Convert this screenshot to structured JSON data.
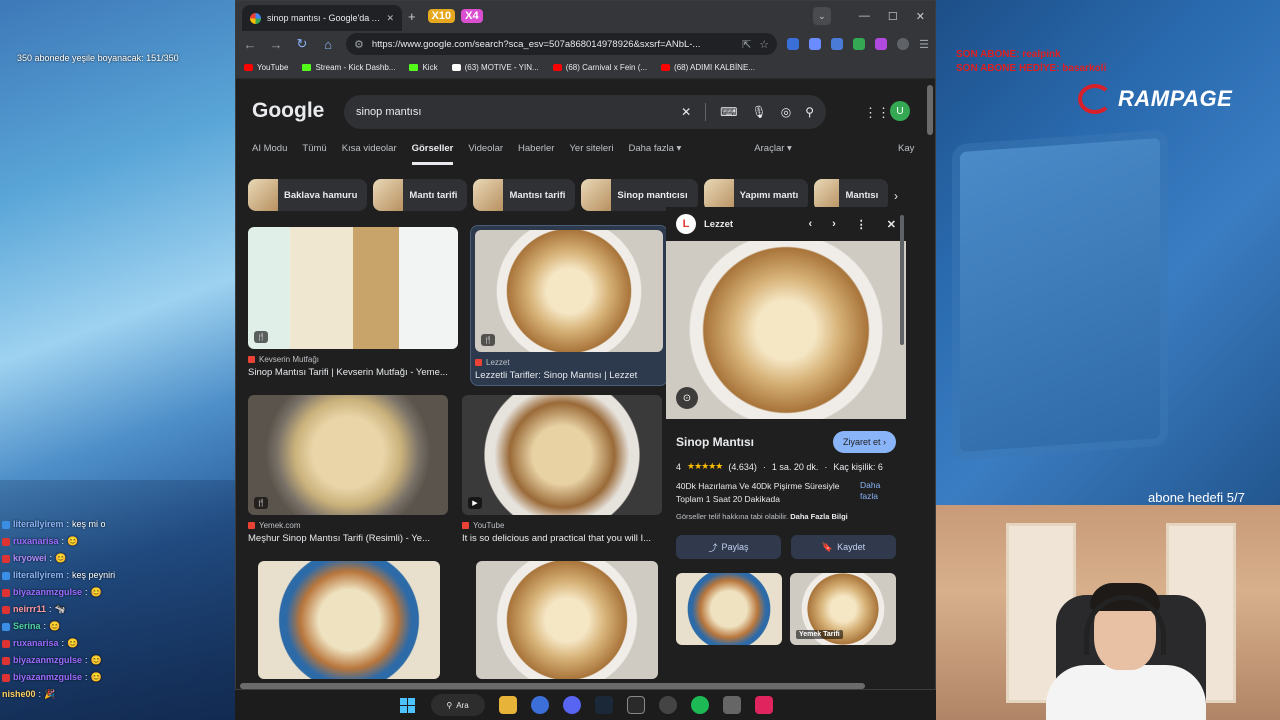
{
  "stream": {
    "sub_counter": "350 abonede yeşile boyanacak: 151/350",
    "last_sub": "SON ABONE: realpink",
    "last_gift": "SON ABONE HEDİYE: basarkoli",
    "brand": "RAMPAGE",
    "goal": "abone hedefi 5/7",
    "stickers": [
      "X10",
      "X4"
    ]
  },
  "chat": [
    {
      "user": "literallyirem",
      "text": "keş mi o",
      "color": "#8ab4f8",
      "badge": "blue"
    },
    {
      "user": "ruxanarisa",
      "text": "😊",
      "color": "#9c6bff",
      "badge": "red"
    },
    {
      "user": "kryowei",
      "text": "😊",
      "color": "#b58cff",
      "badge": "red"
    },
    {
      "user": "literallyirem",
      "text": "keş peyniri",
      "color": "#8ab4f8",
      "badge": "blue"
    },
    {
      "user": "biyazanmzgulse",
      "text": "😊",
      "color": "#9c6bff",
      "badge": "red"
    },
    {
      "user": "neirrr11",
      "text": "🐄",
      "color": "#ff9aa2",
      "badge": "red"
    },
    {
      "user": "Serina",
      "text": "😊",
      "color": "#50d3a0",
      "badge": "blue"
    },
    {
      "user": "ruxanarisa",
      "text": "😊",
      "color": "#9c6bff",
      "badge": "red"
    },
    {
      "user": "biyazanmzgulse",
      "text": "😊",
      "color": "#9c6bff",
      "badge": "red"
    },
    {
      "user": "biyazanmzgulse",
      "text": "😊",
      "color": "#9c6bff",
      "badge": "red"
    },
    {
      "user": "nishe00",
      "text": "🎉",
      "color": "#ffd166",
      "badge": "none"
    }
  ],
  "browser": {
    "tab_title": "sinop mantısı - Google'da Ara",
    "url": "https://www.google.com/search?sca_esv=507a868014978926&sxsrf=ANbL-...",
    "bookmarks": [
      "YouTube",
      "Stream - Kick Dashb...",
      "Kick",
      "(63) MOTIVE - YIN...",
      "(68) Carnival x Fein (...",
      "(68) ADIMI KALBİNE..."
    ]
  },
  "google": {
    "logo": "Google",
    "query": "sinop mantısı",
    "avatar": "U",
    "tabs": [
      "AI Modu",
      "Tümü",
      "Kısa videolar",
      "Görseller",
      "Videolar",
      "Haberler",
      "Yer siteleri",
      "Daha fazla ▾"
    ],
    "active_tab": "Görseller",
    "tools": "Araçlar ▾",
    "save": "Kay",
    "chips": [
      "Baklava hamuru",
      "Mantı tarifi",
      "Mantısı tarifi",
      "Sinop mantıcısı",
      "Yapımı mantı",
      "Mantısı"
    ],
    "results": [
      {
        "source": "Kevserin Mutfağı",
        "title": "Sinop Mantısı Tarifi | Kevserin Mutfağı - Yeme..."
      },
      {
        "source": "Lezzet",
        "title": "Lezzetli Tarifler: Sinop Mantısı | Lezzet"
      },
      {
        "source": "Yemek.com",
        "title": "Meşhur Sinop Mantısı Tarifi (Resimli) - Ye..."
      },
      {
        "source": "YouTube",
        "title": "It is so delicious and practical that you will I..."
      }
    ],
    "panel": {
      "source": "Lezzet",
      "logo_letter": "L",
      "title": "Sinop Mantısı",
      "visit": "Ziyaret et",
      "rating": "4",
      "reviews": "(4.634)",
      "time": "1 sa. 20 dk.",
      "servings": "Kaç kişilik: 6",
      "description": "40Dk Hazırlama Ve 40Dk Pişirme Süresiyle Toplam 1 Saat 20 Dakikada",
      "more": "Daha fazla",
      "disclaimer": "Görseller telif hakkına tabi olabilir.",
      "learn_more": "Daha Fazla Bilgi",
      "share": "Paylaş",
      "save": "Kaydet",
      "related_label": "Yemek Tarifi"
    }
  },
  "taskbar": {
    "search": "Ara"
  }
}
